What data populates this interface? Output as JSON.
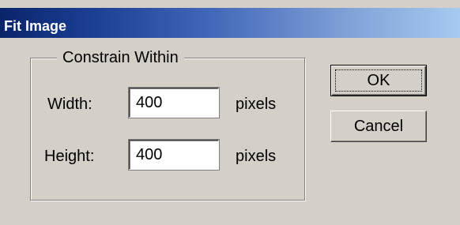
{
  "dialog": {
    "title": "Fit Image"
  },
  "constrain_group": {
    "legend": "Constrain Within",
    "width": {
      "label": "Width:",
      "value": "400",
      "unit": "pixels"
    },
    "height": {
      "label": "Height:",
      "value": "400",
      "unit": "pixels"
    }
  },
  "buttons": {
    "ok_label": "OK",
    "cancel_label": "Cancel"
  },
  "colors": {
    "title_gradient_start": "#0a246a",
    "title_gradient_end": "#a6caf0",
    "dialog_face": "#d4d0c8"
  }
}
